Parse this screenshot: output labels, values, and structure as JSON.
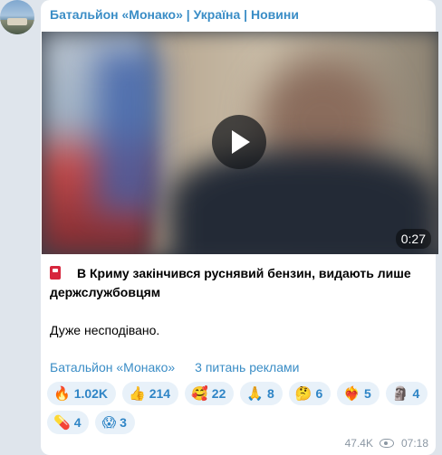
{
  "channel": {
    "name": "Батальйон «Монако» | Україна | Новини"
  },
  "video": {
    "duration": "0:27"
  },
  "post": {
    "icon": "fuel-pump-icon",
    "headline": "В Криму закінчився руснявий бензин, видають лише держслужбовцям",
    "note": "Дуже несподівано."
  },
  "links": {
    "channel_link": "Батальйон «Монако»",
    "ads_link": "3 питань реклами"
  },
  "reactions": [
    {
      "emoji": "🔥",
      "count": "1.02K"
    },
    {
      "emoji": "👍",
      "count": "214"
    },
    {
      "emoji": "🥰",
      "count": "22"
    },
    {
      "emoji": "🙏",
      "count": "8"
    },
    {
      "emoji": "🤔",
      "count": "6"
    },
    {
      "emoji": "❤️‍🔥",
      "count": "5"
    },
    {
      "emoji": "🗿",
      "count": "4"
    },
    {
      "emoji": "💊",
      "count": "4"
    },
    {
      "emoji": "😱",
      "count": "3"
    }
  ],
  "meta": {
    "views": "47.4K",
    "time": "07:18"
  },
  "colors": {
    "accent": "#3a8dc6",
    "reaction_bg": "#e8f1f9",
    "chat_bg": "#dfe5ec"
  }
}
